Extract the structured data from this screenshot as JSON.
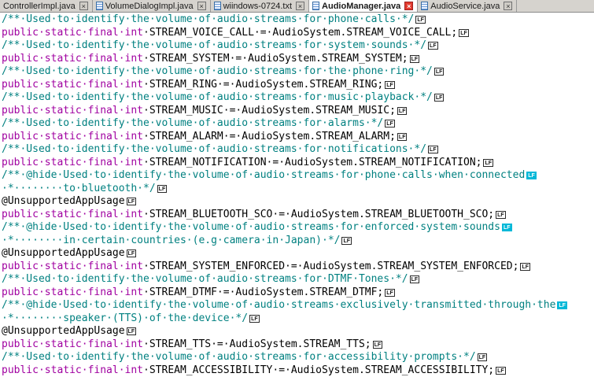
{
  "tabbar": {
    "tabs": [
      {
        "label": "ControllerImpl.java",
        "active": false,
        "has_icon": false,
        "close_label": "×"
      },
      {
        "label": "VolumeDialogImpl.java",
        "active": false,
        "has_icon": true,
        "close_label": "×"
      },
      {
        "label": "wiindows-0724.txt",
        "active": false,
        "has_icon": true,
        "close_label": "×"
      },
      {
        "label": "AudioManager.java",
        "active": true,
        "has_icon": true,
        "close_label": "×"
      },
      {
        "label": "AudioService.java",
        "active": false,
        "has_icon": true,
        "close_label": "×"
      }
    ]
  },
  "editor": {
    "lf_marker": "LF",
    "lines": [
      {
        "segments": [
          {
            "text": "/**·Used·to·identify·the·volume·of·audio·streams·for·phone·calls·*/",
            "type": "comment"
          }
        ],
        "lf": "normal"
      },
      {
        "segments": [
          {
            "text": "public·static·final·int",
            "type": "keyword"
          },
          {
            "text": "·STREAM_VOICE_CALL·=·AudioSystem.STREAM_VOICE_CALL;",
            "type": "plain"
          }
        ],
        "lf": "normal"
      },
      {
        "segments": [
          {
            "text": "/**·Used·to·identify·the·volume·of·audio·streams·for·system·sounds·*/",
            "type": "comment"
          }
        ],
        "lf": "normal"
      },
      {
        "segments": [
          {
            "text": "public·static·final·int",
            "type": "keyword"
          },
          {
            "text": "·STREAM_SYSTEM·=·AudioSystem.STREAM_SYSTEM;",
            "type": "plain"
          }
        ],
        "lf": "normal"
      },
      {
        "segments": [
          {
            "text": "/**·Used·to·identify·the·volume·of·audio·streams·for·the·phone·ring·*/",
            "type": "comment"
          }
        ],
        "lf": "normal"
      },
      {
        "segments": [
          {
            "text": "public·static·final·int",
            "type": "keyword"
          },
          {
            "text": "·STREAM_RING·=·AudioSystem.STREAM_RING;",
            "type": "plain"
          }
        ],
        "lf": "normal"
      },
      {
        "segments": [
          {
            "text": "/**·Used·to·identify·the·volume·of·audio·streams·for·music·playback·*/",
            "type": "comment"
          }
        ],
        "lf": "normal"
      },
      {
        "segments": [
          {
            "text": "public·static·final·int",
            "type": "keyword"
          },
          {
            "text": "·STREAM_MUSIC·=·AudioSystem.STREAM_MUSIC;",
            "type": "plain"
          }
        ],
        "lf": "normal"
      },
      {
        "segments": [
          {
            "text": "/**·Used·to·identify·the·volume·of·audio·streams·for·alarms·*/",
            "type": "comment"
          }
        ],
        "lf": "normal"
      },
      {
        "segments": [
          {
            "text": "public·static·final·int",
            "type": "keyword"
          },
          {
            "text": "·STREAM_ALARM·=·AudioSystem.STREAM_ALARM;",
            "type": "plain"
          }
        ],
        "lf": "normal"
      },
      {
        "segments": [
          {
            "text": "/**·Used·to·identify·the·volume·of·audio·streams·for·notifications·*/",
            "type": "comment"
          }
        ],
        "lf": "normal"
      },
      {
        "segments": [
          {
            "text": "public·static·final·int",
            "type": "keyword"
          },
          {
            "text": "·STREAM_NOTIFICATION·=·AudioSystem.STREAM_NOTIFICATION;",
            "type": "plain"
          }
        ],
        "lf": "normal"
      },
      {
        "segments": [
          {
            "text": "/**·@hide·Used·to·identify·the·volume·of·audio·streams·for·phone·calls·when·connected",
            "type": "comment"
          }
        ],
        "lf": "highlight"
      },
      {
        "segments": [
          {
            "text": "·*········to·bluetooth·*/",
            "type": "comment"
          }
        ],
        "lf": "normal"
      },
      {
        "segments": [
          {
            "text": "@UnsupportedAppUsage",
            "type": "plain"
          }
        ],
        "lf": "normal"
      },
      {
        "segments": [
          {
            "text": "public·static·final·int",
            "type": "keyword"
          },
          {
            "text": "·STREAM_BLUETOOTH_SCO·=·AudioSystem.STREAM_BLUETOOTH_SCO;",
            "type": "plain"
          }
        ],
        "lf": "normal"
      },
      {
        "segments": [
          {
            "text": "/**·@hide·Used·to·identify·the·volume·of·audio·streams·for·enforced·system·sounds",
            "type": "comment"
          }
        ],
        "lf": "highlight"
      },
      {
        "segments": [
          {
            "text": "·*········in·certain·countries·(e.g·camera·in·Japan)·*/",
            "type": "comment"
          }
        ],
        "lf": "normal"
      },
      {
        "segments": [
          {
            "text": "@UnsupportedAppUsage",
            "type": "plain"
          }
        ],
        "lf": "normal"
      },
      {
        "segments": [
          {
            "text": "public·static·final·int",
            "type": "keyword"
          },
          {
            "text": "·STREAM_SYSTEM_ENFORCED·=·AudioSystem.STREAM_SYSTEM_ENFORCED;",
            "type": "plain"
          }
        ],
        "lf": "normal"
      },
      {
        "segments": [
          {
            "text": "/**·Used·to·identify·the·volume·of·audio·streams·for·DTMF·Tones·*/",
            "type": "comment"
          }
        ],
        "lf": "normal"
      },
      {
        "segments": [
          {
            "text": "public·static·final·int",
            "type": "keyword"
          },
          {
            "text": "·STREAM_DTMF·=·AudioSystem.STREAM_DTMF;",
            "type": "plain"
          }
        ],
        "lf": "normal"
      },
      {
        "segments": [
          {
            "text": "/**·@hide·Used·to·identify·the·volume·of·audio·streams·exclusively·transmitted·through·the",
            "type": "comment"
          }
        ],
        "lf": "highlight"
      },
      {
        "segments": [
          {
            "text": "·*········speaker·(TTS)·of·the·device·*/",
            "type": "comment"
          }
        ],
        "lf": "normal"
      },
      {
        "segments": [
          {
            "text": "@UnsupportedAppUsage",
            "type": "plain"
          }
        ],
        "lf": "normal"
      },
      {
        "segments": [
          {
            "text": "public·static·final·int",
            "type": "keyword"
          },
          {
            "text": "·STREAM_TTS·=·AudioSystem.STREAM_TTS;",
            "type": "plain"
          }
        ],
        "lf": "normal"
      },
      {
        "segments": [
          {
            "text": "/**·Used·to·identify·the·volume·of·audio·streams·for·accessibility·prompts·*/",
            "type": "comment"
          }
        ],
        "lf": "normal"
      },
      {
        "segments": [
          {
            "text": "public·static·final·int",
            "type": "keyword"
          },
          {
            "text": "·STREAM_ACCESSIBILITY·=·AudioSystem.STREAM_ACCESSIBILITY;",
            "type": "plain"
          }
        ],
        "lf": "normal"
      }
    ]
  },
  "colors": {
    "comment": "#008080",
    "keyword": "#a000a0",
    "plain": "#000000",
    "lf_highlight_bg": "#00b8d8",
    "active_close_bg": "#e23b2e",
    "tabbar_bg": "#d6d3ce"
  }
}
